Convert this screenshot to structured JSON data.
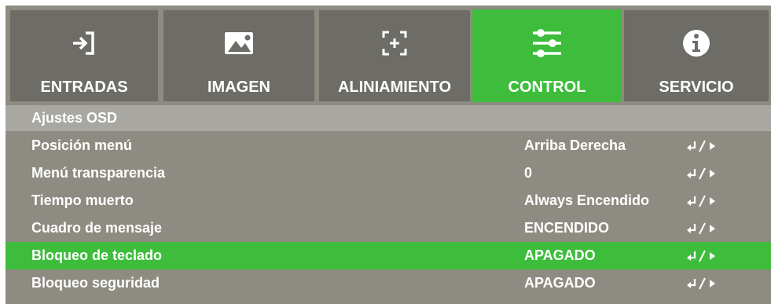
{
  "tabs": [
    {
      "label": "ENTRADAS",
      "icon": "input-icon",
      "active": false
    },
    {
      "label": "IMAGEN",
      "icon": "image-icon",
      "active": false
    },
    {
      "label": "ALINIAMIENTO",
      "icon": "alignment-icon",
      "active": false
    },
    {
      "label": "CONTROL",
      "icon": "sliders-icon",
      "active": true
    },
    {
      "label": "SERVICIO",
      "icon": "info-icon",
      "active": false
    }
  ],
  "section": {
    "title": "Ajustes OSD"
  },
  "rows": [
    {
      "name": "Posición menú",
      "value": "Arriba Derecha",
      "control_icon": "enter-arrow-icon",
      "selected": false
    },
    {
      "name": "Menú transparencia",
      "value": "0",
      "control_icon": "enter-arrow-icon",
      "selected": false
    },
    {
      "name": "Tiempo muerto",
      "value": "Always Encendido",
      "control_icon": "enter-arrow-icon",
      "selected": false
    },
    {
      "name": "Cuadro de mensaje",
      "value": "ENCENDIDO",
      "control_icon": "enter-arrow-icon",
      "selected": false
    },
    {
      "name": "Bloqueo de teclado",
      "value": "APAGADO",
      "control_icon": "enter-arrow-icon",
      "selected": true
    },
    {
      "name": "Bloqueo seguridad",
      "value": "APAGADO",
      "control_icon": "enter-arrow-icon",
      "selected": false
    }
  ],
  "colors": {
    "active": "#3dbd3b",
    "tab_bg": "#6e6c66",
    "panel_bg": "#8e8c82",
    "header_bg": "#a8a7a1",
    "text": "#ffffff"
  }
}
